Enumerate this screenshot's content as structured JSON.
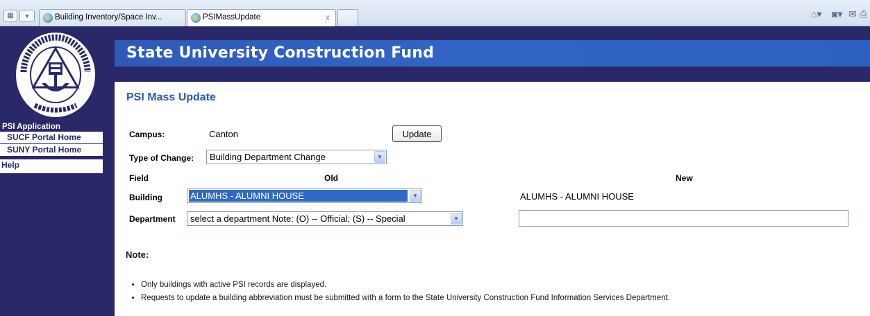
{
  "browser": {
    "tabs": [
      {
        "label": "Building Inventory/Space Inv..."
      },
      {
        "label": "PSIMassUpdate",
        "close": "x"
      }
    ],
    "quick_tabs_icon": "quick-tabs-icon",
    "tab_list_icon": "tab-list-icon"
  },
  "banner": {
    "title": "State University Construction Fund"
  },
  "sidebar": {
    "seal_text": "STATE UNIVERSITY CONSTRUCTION FUND · NEW YORK",
    "app_title": "PSI Application",
    "items": [
      {
        "label": "SUCF Portal Home"
      },
      {
        "label": "SUNY Portal Home"
      },
      {
        "label": "Help"
      }
    ]
  },
  "form": {
    "heading": "PSI Mass Update",
    "campus_label": "Campus:",
    "campus_value": "Canton",
    "update_button": "Update",
    "type_label": "Type of Change:",
    "type_value": "Building Department Change",
    "col_field": "Field",
    "col_old": "Old",
    "col_new": "New",
    "building_label": "Building",
    "building_value": "ALUMHS - ALUMNI HOUSE",
    "building_new": "ALUMHS - ALUMNI HOUSE",
    "department_label": "Department",
    "department_value": "select a department Note: (O) -- Official; (S) -- Special",
    "department_new": ""
  },
  "notes": {
    "title": "Note:",
    "items": [
      "Only buildings with active PSI records are displayed.",
      "Requests to update a building abbreviation must be submitted with a form to the State University Construction Fund Information Services Department."
    ]
  },
  "colors": {
    "navy": "#29296a",
    "banner_blue": "#3166c6",
    "heading_blue": "#2d5bb5",
    "selection": "#316ac5"
  }
}
